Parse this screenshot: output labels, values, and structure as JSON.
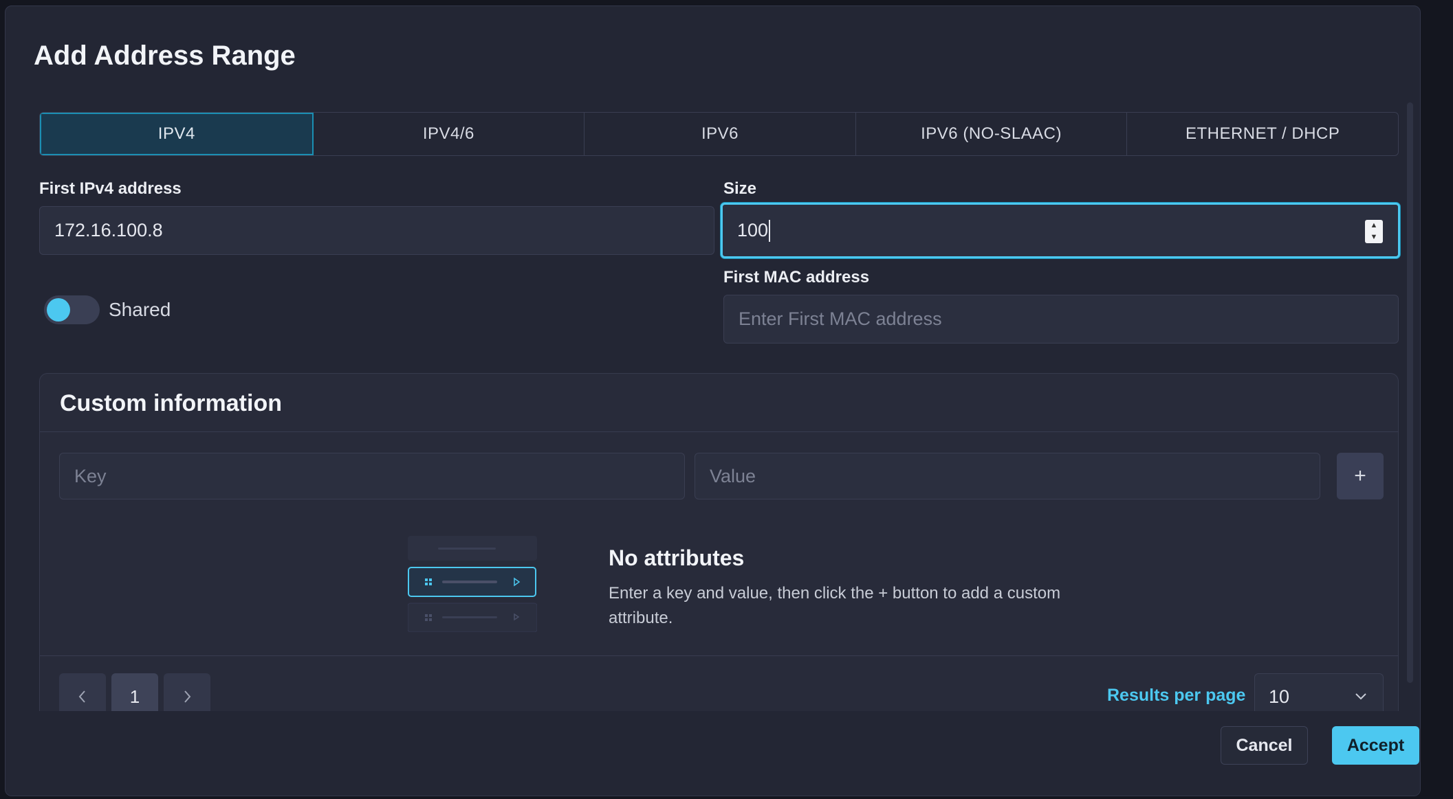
{
  "dialog": {
    "title": "Add Address Range"
  },
  "tabs": [
    {
      "label": "IPV4",
      "active": true
    },
    {
      "label": "IPV4/6",
      "active": false
    },
    {
      "label": "IPV6",
      "active": false
    },
    {
      "label": "IPV6 (NO-SLAAC)",
      "active": false
    },
    {
      "label": "ETHERNET / DHCP",
      "active": false
    }
  ],
  "form": {
    "first_ipv4": {
      "label": "First IPv4 address",
      "value": "172.16.100.8"
    },
    "size": {
      "label": "Size",
      "value": "100"
    },
    "first_mac": {
      "label": "First MAC address",
      "placeholder": "Enter First MAC address"
    },
    "shared": {
      "label": "Shared",
      "on": true
    }
  },
  "custom_info": {
    "title": "Custom information",
    "key_placeholder": "Key",
    "value_placeholder": "Value",
    "add_label": "+",
    "empty": {
      "title": "No attributes",
      "text": "Enter a key and value, then click the + button to add a custom attribute."
    },
    "pagination": {
      "prev_icon": "chevron-left-icon",
      "current_page": "1",
      "next_icon": "chevron-right-icon",
      "results_per_page_label": "Results per page",
      "results_per_page_value": "10"
    }
  },
  "footer": {
    "cancel_label": "Cancel",
    "accept_label": "Accept"
  },
  "colors": {
    "accent": "#4cc8f0",
    "background": "#232634",
    "active_tab": "#1a3a4f"
  }
}
